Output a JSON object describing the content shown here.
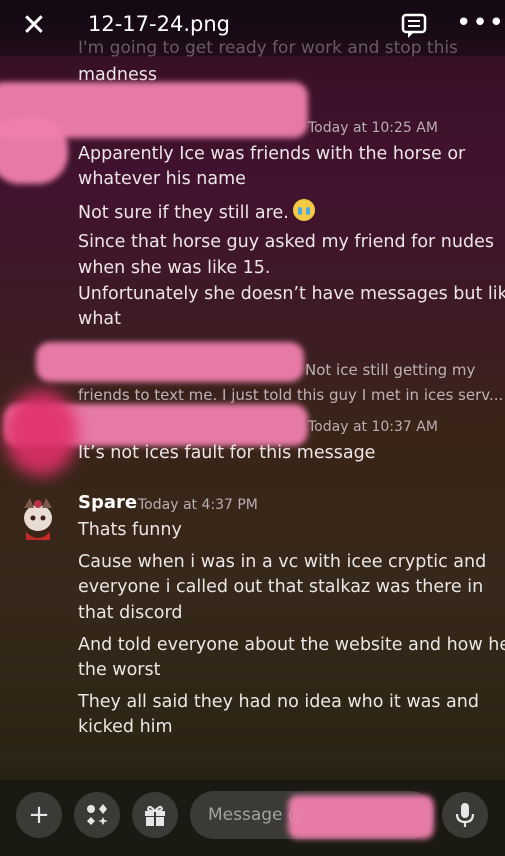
{
  "header": {
    "file_title": "12-17-24.png"
  },
  "messages": {
    "ghost_line": "I'm going to get ready for work and stop this",
    "madness": "madness",
    "ts_1025": "Today at 10:25 AM",
    "l1": "Apparently Ice was friends with the horse or",
    "l2": "whatever his name",
    "l3": "Not sure if they still are.",
    "l4": "Since that horse guy asked my friend for nudes",
    "l5": "when she was like 15.",
    "l6": "Unfortunately she doesn’t have messages but like",
    "l7": "what",
    "reply_1": "Not ice still getting my",
    "reply_2": "friends to text me.  I just told this guy I met in ices serv...",
    "ts_1037": "Today at 10:37 AM",
    "l8": "It’s not ices fault for this message",
    "username": "Spare",
    "ts_437": "Today at 4:37 PM",
    "s1": "Thats funny",
    "s2": "Cause when i was in a vc with icee cryptic and",
    "s3": "everyone i called out that stalkaz was there in",
    "s4": "that discord",
    "s5": "And told everyone about the website and how hes",
    "s6": "the worst",
    "s7": "They all said they had no idea who it was and",
    "s8": "kicked him"
  },
  "composer": {
    "plus_icon": "+",
    "placeholder": "Message @"
  },
  "icons": [
    "close-icon",
    "thread-icon",
    "more-icon",
    "apps-icon",
    "gift-icon",
    "mic-icon",
    "crying-emoji"
  ]
}
